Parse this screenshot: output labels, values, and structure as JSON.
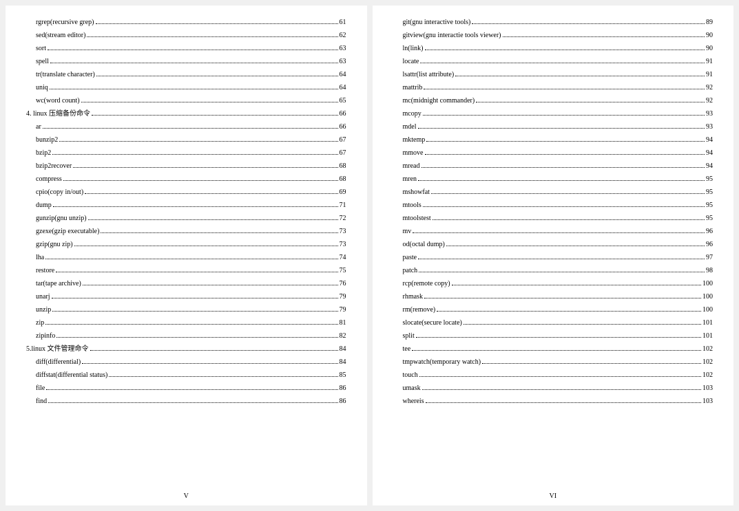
{
  "pages": [
    {
      "footer": "V",
      "entries": [
        {
          "label": "rgrep(recursive grep)",
          "page": "61",
          "indent": true
        },
        {
          "label": "sed(stream editor)",
          "page": "62",
          "indent": true
        },
        {
          "label": "sort",
          "page": "63",
          "indent": true
        },
        {
          "label": "spell",
          "page": "63",
          "indent": true
        },
        {
          "label": "tr(translate character)",
          "page": "64",
          "indent": true
        },
        {
          "label": "uniq",
          "page": "64",
          "indent": true
        },
        {
          "label": "wc(word count)",
          "page": "65",
          "indent": true
        },
        {
          "label": "4. linux 压缩备份命令",
          "page": "66",
          "indent": false
        },
        {
          "label": "ar",
          "page": "66",
          "indent": true
        },
        {
          "label": "bunzip2",
          "page": "67",
          "indent": true
        },
        {
          "label": "bzip2",
          "page": "67",
          "indent": true
        },
        {
          "label": "bzip2recover",
          "page": "68",
          "indent": true
        },
        {
          "label": "compress",
          "page": "68",
          "indent": true
        },
        {
          "label": "cpio(copy in/out)",
          "page": "69",
          "indent": true
        },
        {
          "label": "dump",
          "page": "71",
          "indent": true
        },
        {
          "label": "gunzip(gnu unzip)",
          "page": "72",
          "indent": true
        },
        {
          "label": "gzexe(gzip executable)",
          "page": "73",
          "indent": true
        },
        {
          "label": "gzip(gnu zip)",
          "page": "73",
          "indent": true
        },
        {
          "label": "lha",
          "page": "74",
          "indent": true
        },
        {
          "label": "restore",
          "page": "75",
          "indent": true
        },
        {
          "label": "tar(tape archive)",
          "page": "76",
          "indent": true
        },
        {
          "label": "unarj",
          "page": "79",
          "indent": true
        },
        {
          "label": "unzip",
          "page": "79",
          "indent": true
        },
        {
          "label": "zip",
          "page": "81",
          "indent": true
        },
        {
          "label": "zipinfo",
          "page": "82",
          "indent": true
        },
        {
          "label": "5.linux 文件管理命令",
          "page": "84",
          "indent": false
        },
        {
          "label": "diff(differential)",
          "page": "84",
          "indent": true
        },
        {
          "label": "diffstat(differential status)",
          "page": "85",
          "indent": true
        },
        {
          "label": "file",
          "page": "86",
          "indent": true
        },
        {
          "label": "find",
          "page": "86",
          "indent": true
        }
      ]
    },
    {
      "footer": "VI",
      "entries": [
        {
          "label": "git(gnu interactive tools)",
          "page": "89",
          "indent": true
        },
        {
          "label": "gitview(gnu interactie tools viewer)",
          "page": "90",
          "indent": true
        },
        {
          "label": "ln(link)",
          "page": "90",
          "indent": true
        },
        {
          "label": "locate",
          "page": "91",
          "indent": true
        },
        {
          "label": "lsattr(list attribute)",
          "page": "91",
          "indent": true
        },
        {
          "label": "mattrib",
          "page": "92",
          "indent": true
        },
        {
          "label": "mc(midnight commander)",
          "page": "92",
          "indent": true
        },
        {
          "label": "mcopy",
          "page": "93",
          "indent": true
        },
        {
          "label": "mdel",
          "page": "93",
          "indent": true
        },
        {
          "label": "mktemp",
          "page": "94",
          "indent": true
        },
        {
          "label": "mmove",
          "page": "94",
          "indent": true
        },
        {
          "label": "mread",
          "page": "94",
          "indent": true
        },
        {
          "label": "mren",
          "page": "95",
          "indent": true
        },
        {
          "label": "mshowfat",
          "page": "95",
          "indent": true
        },
        {
          "label": "mtools",
          "page": "95",
          "indent": true
        },
        {
          "label": "mtoolstest",
          "page": "95",
          "indent": true
        },
        {
          "label": "mv",
          "page": "96",
          "indent": true
        },
        {
          "label": "od(octal dump)",
          "page": "96",
          "indent": true
        },
        {
          "label": "paste",
          "page": "97",
          "indent": true
        },
        {
          "label": "patch",
          "page": "98",
          "indent": true
        },
        {
          "label": "rcp(remote copy)",
          "page": "100",
          "indent": true
        },
        {
          "label": "rhmask",
          "page": "100",
          "indent": true
        },
        {
          "label": "rm(remove)",
          "page": "100",
          "indent": true
        },
        {
          "label": "slocate(secure locate)",
          "page": "101",
          "indent": true
        },
        {
          "label": "split",
          "page": "101",
          "indent": true
        },
        {
          "label": "tee",
          "page": "102",
          "indent": true
        },
        {
          "label": "tmpwatch(temporary watch)",
          "page": "102",
          "indent": true
        },
        {
          "label": "touch",
          "page": "102",
          "indent": true
        },
        {
          "label": "umask",
          "page": "103",
          "indent": true
        },
        {
          "label": "whereis",
          "page": "103",
          "indent": true
        }
      ]
    }
  ]
}
